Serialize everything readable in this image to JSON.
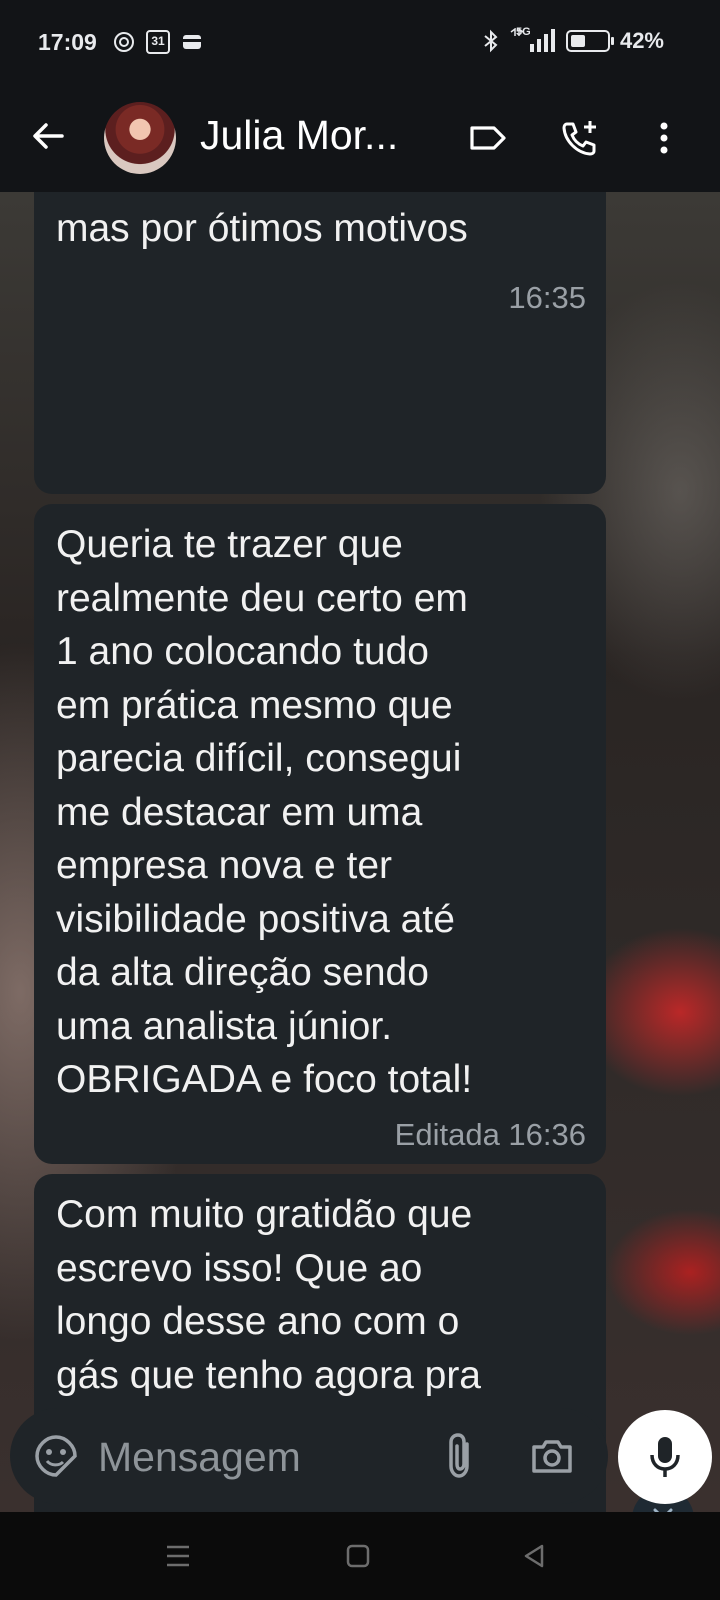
{
  "status_bar": {
    "time": "17:09",
    "left_icons": [
      "vpn-icon",
      "calendar-icon",
      "card-icon"
    ],
    "calendar_day": "31",
    "network": "5G",
    "battery": "42%"
  },
  "header": {
    "contact_name": "Julia Mor...",
    "icons": [
      "back-arrow-icon",
      "label-icon",
      "add-call-icon",
      "more-vert-icon"
    ]
  },
  "messages": [
    {
      "text": "mas por ótimos motivos",
      "meta": "16:35"
    },
    {
      "text": "Queria te trazer que\nrealmente deu certo em\n1 ano colocando tudo\nem prática mesmo que\nparecia difícil, consegui\nme destacar em uma\nempresa nova e ter\nvisibilidade positiva até\nda alta direção sendo\numa analista júnior.\nOBRIGADA e foco total!",
      "meta": "Editada 16:36"
    },
    {
      "text": "Com muito gratidão que\nescrevo isso! Que ao\nlongo desse ano com o\ngás que tenho agora pra\nconquistar e entregar\no melhor de mim no\ntão sonhado cargo de\nliderança. Não sou mais",
      "meta": ""
    }
  ],
  "composer": {
    "placeholder": "Mensagem",
    "icons": [
      "sticker-icon",
      "attach-icon",
      "camera-icon",
      "mic-icon"
    ]
  },
  "navigation": [
    "menu-icon",
    "home-icon",
    "back-icon"
  ],
  "colors": {
    "bar_bg": "#121417",
    "bubble_bg": "#1f2428",
    "meta_text": "#9aa0a6",
    "mic_button": "#ffffff"
  }
}
